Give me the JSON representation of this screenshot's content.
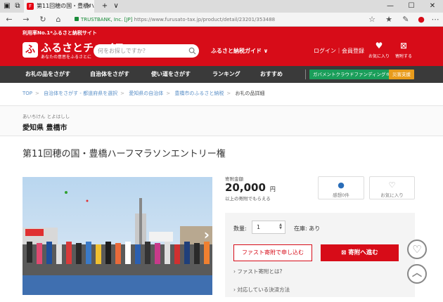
{
  "browser": {
    "tab_title": "第11回穂の国・豊橋ハーフ",
    "new_tab": "+",
    "url_site": "TRUSTBANK, Inc. [JP]",
    "url_path": "https://www.furusato-tax.jp/product/detail/23201/353488"
  },
  "header": {
    "tagline": "利用率No.1*ふるさと納税サイト",
    "logo_text": "ふるさとチョイス",
    "logo_sub": "あなたの意思をふるさとに",
    "search_placeholder": "何をお探しですか？",
    "guide": "ふるさと納税ガイド ∨",
    "login": "ログイン｜会員登録",
    "favorites": "お気に入り",
    "donation_list": "寄附する"
  },
  "nav": {
    "items": [
      "お礼の品をさがす",
      "自治体をさがす",
      "使い道をさがす",
      "ランキング",
      "おすすめ"
    ],
    "gov_crowdfunding": "ガバメントクラウドファンディング®",
    "disaster": "災害支援"
  },
  "breadcrumbs": [
    "TOP",
    "自治体をさがす - 都道府県を選択",
    "愛知県の自治体",
    "豊橋市のふるさと納税",
    "お礼の品詳細"
  ],
  "municipality": {
    "kana": "あいちけん とよはしし",
    "name": "愛知県 豊橋市"
  },
  "product": {
    "title": "第11回穂の国・豊橋ハーフマラソンエントリー権",
    "amount_label": "寄附金額",
    "amount": "20,000",
    "yen": "円",
    "amount_note": "以上の寄附でもらえる",
    "reviews": "感想0件",
    "favorite": "お気に入り",
    "qty_label": "数量:",
    "qty_value": "1",
    "stock": "在庫: あり",
    "fast_button": "ファスト寄附で申し込む",
    "donate_button": "寄附へ進む",
    "link_fast": "› ファスト寄附とは?",
    "link_payment": "› 対応している決済方法"
  },
  "colors": {
    "brand_red": "#d70c18",
    "nav_dark": "#3a3a3a",
    "gov_green": "#1a9e5a",
    "disaster_orange": "#e89b1b"
  }
}
